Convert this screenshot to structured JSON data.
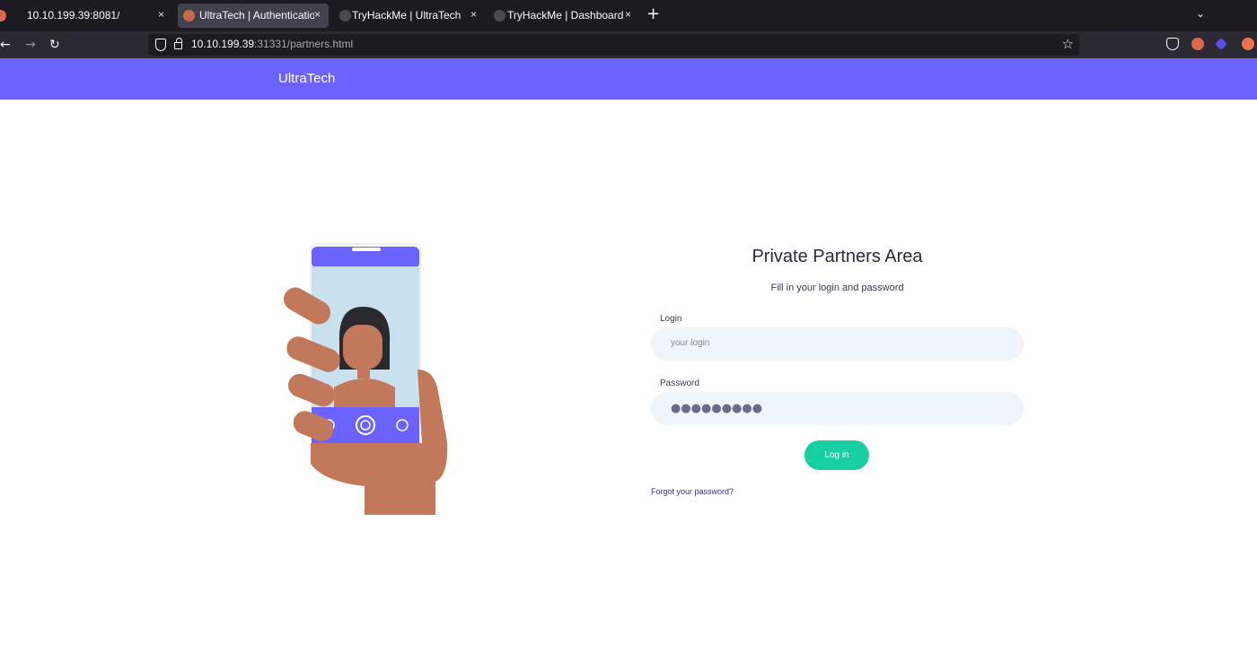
{
  "browser": {
    "tabs": [
      {
        "label": "10.10.199.39:8081/",
        "active": false
      },
      {
        "label": "UltraTech | Authenticatio",
        "active": true
      },
      {
        "label": "TryHackMe | UltraTech",
        "active": false
      },
      {
        "label": "TryHackMe | Dashboard",
        "active": false
      }
    ],
    "url_host": "10.10.199.39",
    "url_rest": ":31331/partners.html",
    "new_tab_glyph": "+",
    "close_glyph": "×"
  },
  "site": {
    "brand": "UltraTech"
  },
  "login": {
    "title": "Private Partners Area",
    "subtitle": "Fill in your login and password",
    "login_label": "Login",
    "login_placeholder": "your login",
    "password_label": "Password",
    "password_mask": "●●●●●●●●●",
    "submit_label": "Log in",
    "forgot_label": "Forgot your password?"
  },
  "colors": {
    "header": "#6c63ff",
    "accent": "#17cfa0",
    "field_bg": "#eef5fb"
  }
}
